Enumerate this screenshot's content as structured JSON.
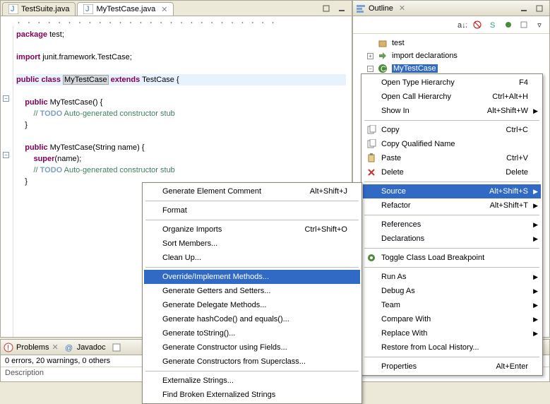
{
  "editor": {
    "tabs": [
      {
        "label": "TestSuite.java",
        "active": false
      },
      {
        "label": "MyTestCase.java",
        "active": true
      }
    ],
    "code_tokens": {
      "package_kw": "package",
      "package_name": " test;",
      "import_kw": "import",
      "import_name": " junit.framework.TestCase;",
      "public_kw": "public",
      "class_kw": "class",
      "class_name": "MyTestCase",
      "extends_kw": "extends",
      "super_name": " TestCase {",
      "ctor1_sig": " MyTestCase() {",
      "todo_kw": "TODO",
      "todo_text": " Auto-generated constructor stub",
      "close_brace": "}",
      "ctor2_sig": " MyTestCase(String name) {",
      "super_kw": "super",
      "super_call": "(name);",
      "slashes": "// "
    }
  },
  "outline": {
    "title": "Outline",
    "nodes": {
      "root": "test",
      "imports": "import declarations",
      "class": "MyTestCase"
    }
  },
  "context_menu1": {
    "items": [
      {
        "label": "Open Type Hierarchy",
        "shortcut": "F4"
      },
      {
        "label": "Open Call Hierarchy",
        "shortcut": "Ctrl+Alt+H"
      },
      {
        "label": "Show In",
        "shortcut": "Alt+Shift+W",
        "arrow": true
      },
      {
        "sep": true
      },
      {
        "label": "Copy",
        "shortcut": "Ctrl+C",
        "icon": "copy"
      },
      {
        "label": "Copy Qualified Name",
        "icon": "copy"
      },
      {
        "label": "Paste",
        "shortcut": "Ctrl+V",
        "icon": "paste"
      },
      {
        "label": "Delete",
        "shortcut": "Delete",
        "icon": "delete"
      },
      {
        "sep": true
      },
      {
        "label": "Source",
        "shortcut": "Alt+Shift+S",
        "arrow": true,
        "hl": true
      },
      {
        "label": "Refactor",
        "shortcut": "Alt+Shift+T",
        "arrow": true
      },
      {
        "sep": true
      },
      {
        "label": "References",
        "arrow": true
      },
      {
        "label": "Declarations",
        "arrow": true
      },
      {
        "sep": true
      },
      {
        "label": "Toggle Class Load Breakpoint",
        "icon": "breakpoint"
      },
      {
        "sep": true
      },
      {
        "label": "Run As",
        "arrow": true
      },
      {
        "label": "Debug As",
        "arrow": true
      },
      {
        "label": "Team",
        "arrow": true
      },
      {
        "label": "Compare With",
        "arrow": true
      },
      {
        "label": "Replace With",
        "arrow": true
      },
      {
        "label": "Restore from Local History..."
      },
      {
        "sep": true
      },
      {
        "label": "Properties",
        "shortcut": "Alt+Enter"
      }
    ]
  },
  "context_menu2": {
    "items": [
      {
        "label": "Generate Element Comment",
        "shortcut": "Alt+Shift+J"
      },
      {
        "sep": true
      },
      {
        "label": "Format"
      },
      {
        "sep": true
      },
      {
        "label": "Organize Imports",
        "shortcut": "Ctrl+Shift+O"
      },
      {
        "label": "Sort Members..."
      },
      {
        "label": "Clean Up..."
      },
      {
        "sep": true
      },
      {
        "label": "Override/Implement Methods...",
        "hl": true
      },
      {
        "label": "Generate Getters and Setters..."
      },
      {
        "label": "Generate Delegate Methods..."
      },
      {
        "label": "Generate hashCode() and equals()..."
      },
      {
        "label": "Generate toString()..."
      },
      {
        "label": "Generate Constructor using Fields..."
      },
      {
        "label": "Generate Constructors from Superclass..."
      },
      {
        "sep": true
      },
      {
        "label": "Externalize Strings..."
      },
      {
        "label": "Find Broken Externalized Strings"
      }
    ]
  },
  "problems": {
    "tabs": {
      "problems": "Problems",
      "javadoc": "Javadoc"
    },
    "status": "0 errors, 20 warnings, 0 others",
    "description_label": "Description"
  }
}
